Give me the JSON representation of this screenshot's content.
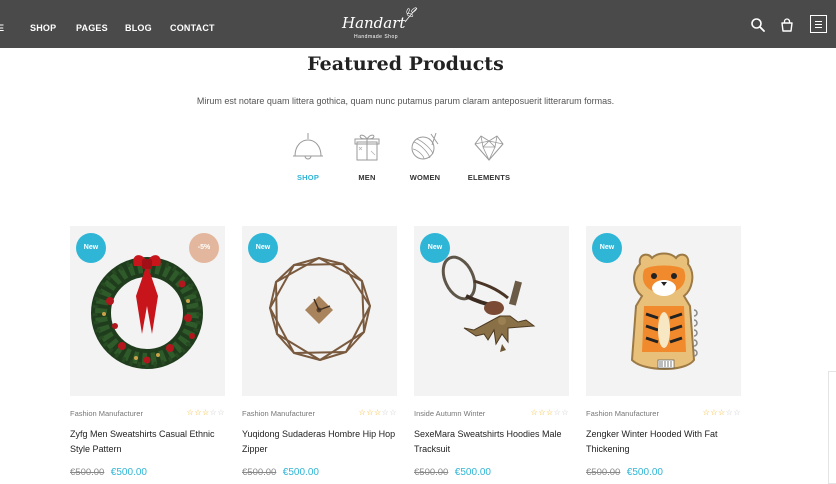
{
  "header": {
    "nav": [
      {
        "label": "E"
      },
      {
        "label": "SHOP"
      },
      {
        "label": "PAGES"
      },
      {
        "label": "BLOG"
      },
      {
        "label": "CONTACT"
      }
    ],
    "logo": {
      "text": "Handart",
      "sub": "Handmade Shop"
    },
    "icons": [
      "search-icon",
      "cart-icon",
      "menu-icon"
    ]
  },
  "section": {
    "title": "Featured Products",
    "subtitle": "Mirum est notare quam littera gothica, quam nunc putamus parum claram anteposuerit litterarum formas."
  },
  "categories": [
    {
      "label": "SHOP",
      "icon": "lamp-icon",
      "active": true
    },
    {
      "label": "MEN",
      "icon": "gift-icon",
      "active": false
    },
    {
      "label": "WOMEN",
      "icon": "yarn-ball-icon",
      "active": false
    },
    {
      "label": "ELEMENTS",
      "icon": "geometric-heart-icon",
      "active": false
    }
  ],
  "products": [
    {
      "badge": "New",
      "discount": "-5%",
      "brand": "Fashion Manufacturer",
      "rating": 3,
      "rating_max": 5,
      "name": "Zyfg Men Sweatshirts Casual Ethnic Style Pattern",
      "old_price": "€500.00",
      "price": "€500.00",
      "image": "christmas-wreath"
    },
    {
      "badge": "New",
      "brand": "Fashion Manufacturer",
      "rating": 3,
      "rating_max": 5,
      "name": "Yuqidong Sudaderas Hombre Hip Hop Zipper",
      "old_price": "€500.00",
      "price": "€500.00",
      "image": "geometric-wall-clock"
    },
    {
      "badge": "New",
      "brand": "Inside Autumn Winter",
      "rating": 3,
      "rating_max": 5,
      "name": "SexeMara Sweatshirts Hoodies Male Tracksuit",
      "old_price": "€500.00",
      "price": "€500.00",
      "image": "eagle-keychain"
    },
    {
      "badge": "New",
      "brand": "Fashion Manufacturer",
      "rating": 3,
      "rating_max": 5,
      "name": "Zengker Winter Hooded With Fat Thickening",
      "old_price": "€500.00",
      "price": "€500.00",
      "image": "tiger-notebook"
    }
  ],
  "colors": {
    "header_bg": "#4a4a4a",
    "accent": "#2fb6d7",
    "sale_badge": "#e3b79d",
    "star": "#f3b521"
  }
}
